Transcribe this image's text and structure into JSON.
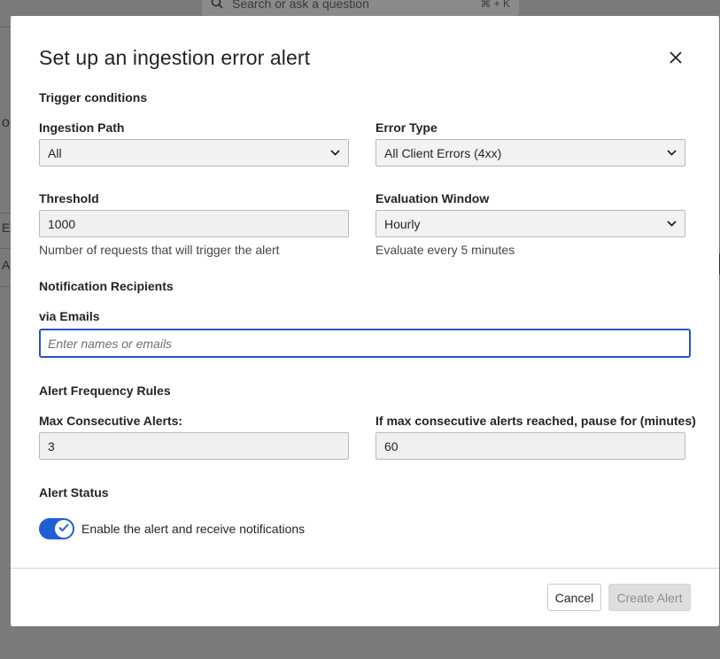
{
  "background": {
    "search_placeholder": "Search or ask a question",
    "search_shortcut": "⌘ + K",
    "fragments": [
      "ou",
      "E",
      "A"
    ]
  },
  "modal": {
    "title": "Set up an ingestion error alert",
    "close_icon": "close-icon"
  },
  "trigger": {
    "section_title": "Trigger conditions",
    "ingestion_path": {
      "label": "Ingestion Path",
      "value": "All"
    },
    "error_type": {
      "label": "Error Type",
      "value": "All Client Errors (4xx)"
    },
    "threshold": {
      "label": "Threshold",
      "value": "1000",
      "help": "Number of requests that will trigger the alert"
    },
    "evaluation_window": {
      "label": "Evaluation Window",
      "value": "Hourly",
      "help": "Evaluate every 5 minutes"
    }
  },
  "recipients": {
    "section_title": "Notification Recipients",
    "emails_label": "via Emails",
    "emails_placeholder": "Enter names or emails"
  },
  "frequency": {
    "section_title": "Alert Frequency Rules",
    "max_consecutive": {
      "label": "Max Consecutive Alerts:",
      "value": "3"
    },
    "pause": {
      "label": "If max consecutive alerts reached, pause for (minutes)",
      "value": "60"
    }
  },
  "status": {
    "section_title": "Alert Status",
    "toggle_label": "Enable the alert and receive notifications",
    "enabled": true
  },
  "footer": {
    "cancel_label": "Cancel",
    "create_label": "Create Alert"
  },
  "colors": {
    "accent": "#1f5fd6",
    "focus_border": "#2b53c4",
    "overlay": "#7a7a7a"
  }
}
